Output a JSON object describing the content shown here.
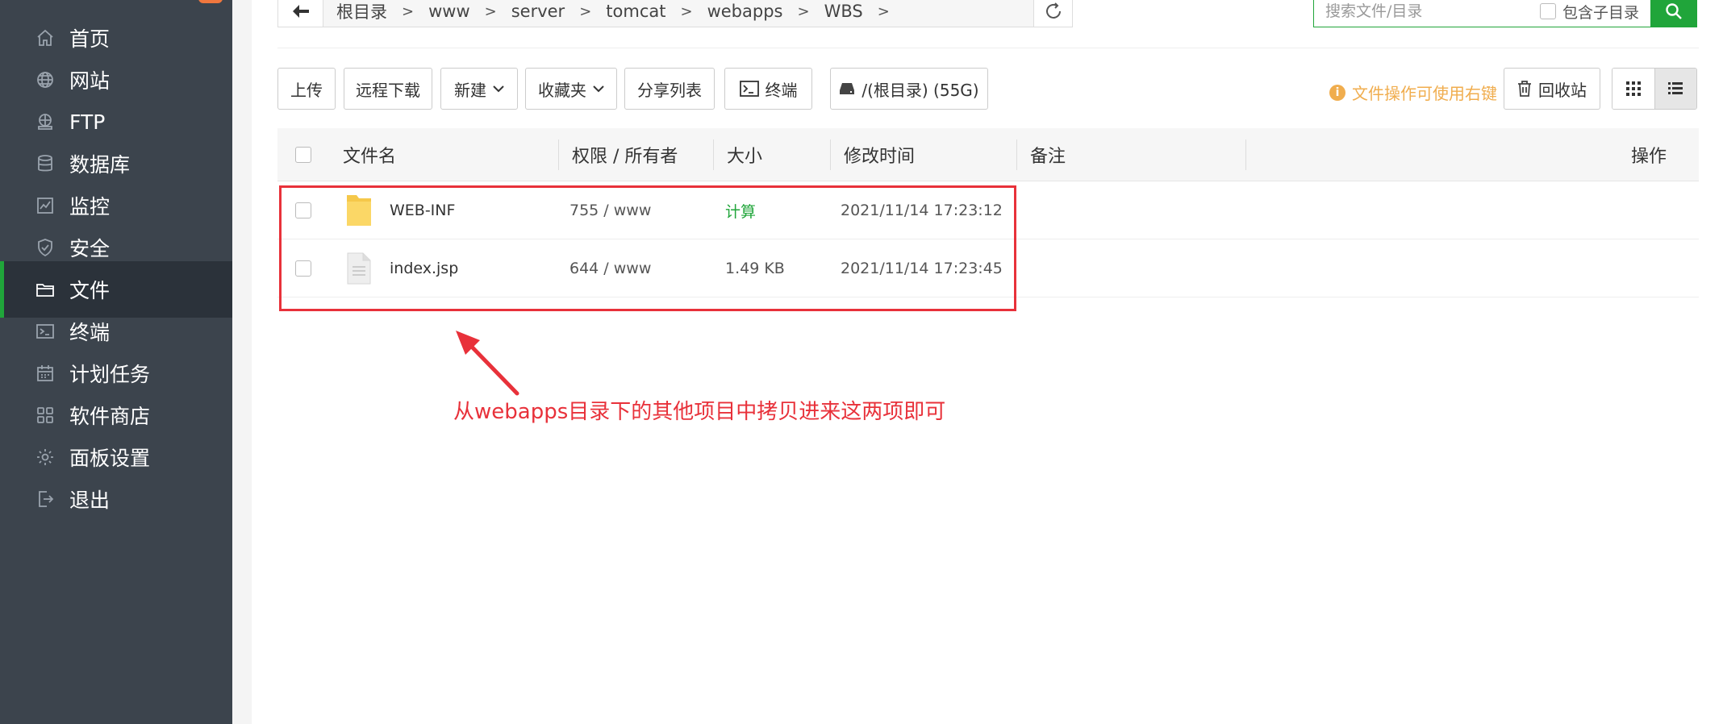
{
  "sidebar": {
    "items": [
      {
        "label": "首页",
        "icon": "home-icon",
        "active": false
      },
      {
        "label": "网站",
        "icon": "globe-icon",
        "active": false
      },
      {
        "label": "FTP",
        "icon": "ftp-icon",
        "active": false
      },
      {
        "label": "数据库",
        "icon": "database-icon",
        "active": false
      },
      {
        "label": "监控",
        "icon": "monitor-icon",
        "active": false
      },
      {
        "label": "安全",
        "icon": "shield-icon",
        "active": false
      },
      {
        "label": "文件",
        "icon": "folder-icon",
        "active": true
      },
      {
        "label": "终端",
        "icon": "terminal-icon",
        "active": false
      },
      {
        "label": "计划任务",
        "icon": "calendar-icon",
        "active": false
      },
      {
        "label": "软件商店",
        "icon": "apps-grid-icon",
        "active": false
      },
      {
        "label": "面板设置",
        "icon": "gear-icon",
        "active": false
      },
      {
        "label": "退出",
        "icon": "logout-icon",
        "active": false
      }
    ]
  },
  "breadcrumb": {
    "items": [
      "根目录",
      "www",
      "server",
      "tomcat",
      "webapps",
      "WBS"
    ]
  },
  "search": {
    "placeholder": "搜索文件/目录",
    "include_subdir_label": "包含子目录"
  },
  "toolbar": {
    "upload": "上传",
    "remote_download": "远程下载",
    "new": "新建",
    "favorites": "收藏夹",
    "share_list": "分享列表",
    "terminal": "终端",
    "disk": "/(根目录) (55G)",
    "tip": "文件操作可使用右键",
    "recycle": "回收站"
  },
  "table": {
    "headers": {
      "name": "文件名",
      "perm": "权限 / 所有者",
      "size": "大小",
      "mtime": "修改时间",
      "note": "备注",
      "actions": "操作"
    },
    "rows": [
      {
        "name": "WEB-INF",
        "type": "folder",
        "perm": "755 / www",
        "size": "计算",
        "mtime": "2021/11/14 17:23:12"
      },
      {
        "name": "index.jsp",
        "type": "file",
        "perm": "644 / www",
        "size": "1.49 KB",
        "mtime": "2021/11/14 17:23:45"
      }
    ]
  },
  "annotation": {
    "text": "从webapps目录下的其他项目中拷贝进来这两项即可",
    "color": "#e8313a"
  },
  "colors": {
    "sidebar_bg": "#3c444d",
    "accent_green": "#20a53a",
    "tip_orange": "#f0ad4e"
  }
}
